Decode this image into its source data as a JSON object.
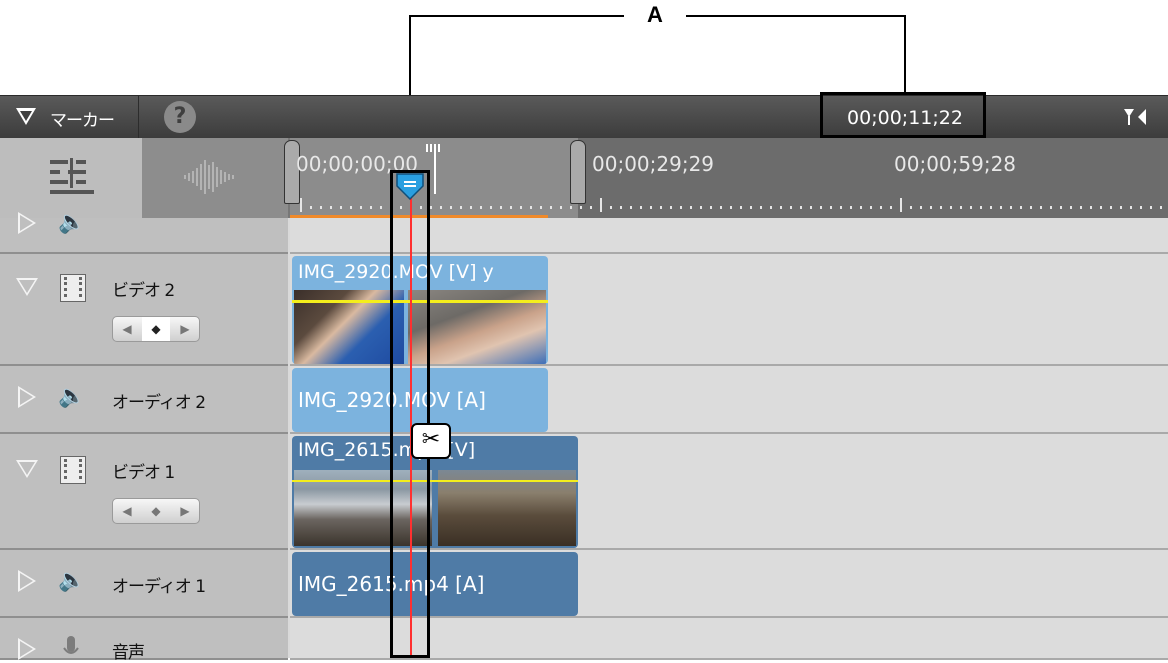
{
  "callout": {
    "label": "A"
  },
  "toolbar": {
    "marker_label": "マーカー",
    "help_label": "?",
    "timecode": "00;00;11;22"
  },
  "ruler": {
    "tick_labels": [
      "00;00;00;00",
      "00;00;29;29",
      "00;00;59;28"
    ]
  },
  "tracks": [
    {
      "name": "ビデオ 2",
      "type": "video"
    },
    {
      "name": "オーディオ 2",
      "type": "audio"
    },
    {
      "name": "ビデオ 1",
      "type": "video"
    },
    {
      "name": "オーディオ 1",
      "type": "audio"
    },
    {
      "name": "音声",
      "type": "voice"
    }
  ],
  "clips": {
    "video2": "IMG_2920.MOV [V] y",
    "audio2": "IMG_2920.MOV [A]",
    "video1": "IMG_2615.mp4 [V]",
    "audio1": "IMG_2615.mp4 [A]"
  },
  "keyframe_nav": {
    "prev": "◀",
    "add": "◆",
    "next": "▶"
  },
  "colors": {
    "clip_top": "#7cb3de",
    "clip_bottom": "#4f7ba6",
    "playhead": "#ff3030",
    "work_area": "#f08a2a"
  }
}
